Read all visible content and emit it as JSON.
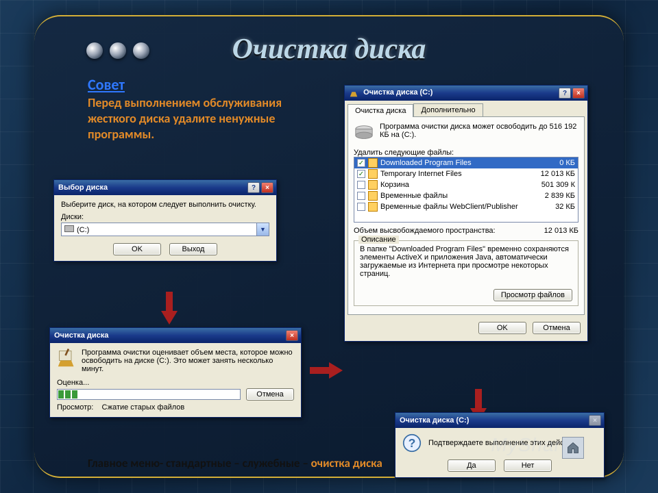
{
  "slide": {
    "title": "Очистка диска",
    "tip_head": "Совет",
    "tip_body": "Перед выполнением обслуживания жесткого диска удалите ненужные программы.",
    "path_prefix": "Главное меню- стандартные – служебные – ",
    "path_accent": "очистка диска",
    "watermark": "MyShared"
  },
  "select_disk": {
    "title": "Выбор диска",
    "prompt": "Выберите диск, на котором следует выполнить очистку.",
    "label": "Диски:",
    "value": "(C:)",
    "ok": "OK",
    "exit": "Выход"
  },
  "scanning": {
    "title": "Очистка диска",
    "msg": "Программа очистки оценивает объем места, которое можно освободить на диске (C:). Это может занять несколько минут.",
    "eval": "Оценка...",
    "view_label": "Просмотр:",
    "view_value": "Сжатие старых файлов",
    "cancel": "Отмена"
  },
  "main": {
    "title": "Очистка диска (C:)",
    "tabs": {
      "cleanup": "Очистка диска",
      "more": "Дополнительно"
    },
    "summary": "Программа очистки диска может освободить до 516 192 КБ на (C:).",
    "list_label": "Удалить следующие файлы:",
    "files": [
      {
        "checked": true,
        "name": "Downloaded Program Files",
        "size": "0 КБ",
        "selected": true
      },
      {
        "checked": true,
        "name": "Temporary Internet Files",
        "size": "12 013 КБ"
      },
      {
        "checked": false,
        "name": "Корзина",
        "size": "501 309 К"
      },
      {
        "checked": false,
        "name": "Временные файлы",
        "size": "2 839 КБ"
      },
      {
        "checked": false,
        "name": "Временные файлы WebClient/Publisher",
        "size": "32 КБ"
      }
    ],
    "free_label": "Объем высвобождаемого пространства:",
    "free_value": "12 013 КБ",
    "desc_legend": "Описание",
    "desc_text": "В папке \"Downloaded Program Files\" временно сохраняются элементы ActiveX и приложения Java, автоматически загружаемые из Интернета при просмотре некоторых страниц.",
    "view_files": "Просмотр файлов",
    "ok": "OK",
    "cancel": "Отмена"
  },
  "confirm": {
    "title": "Очистка диска  (C:)",
    "msg": "Подтверждаете выполнение этих действий?",
    "yes": "Да",
    "no": "Нет"
  }
}
